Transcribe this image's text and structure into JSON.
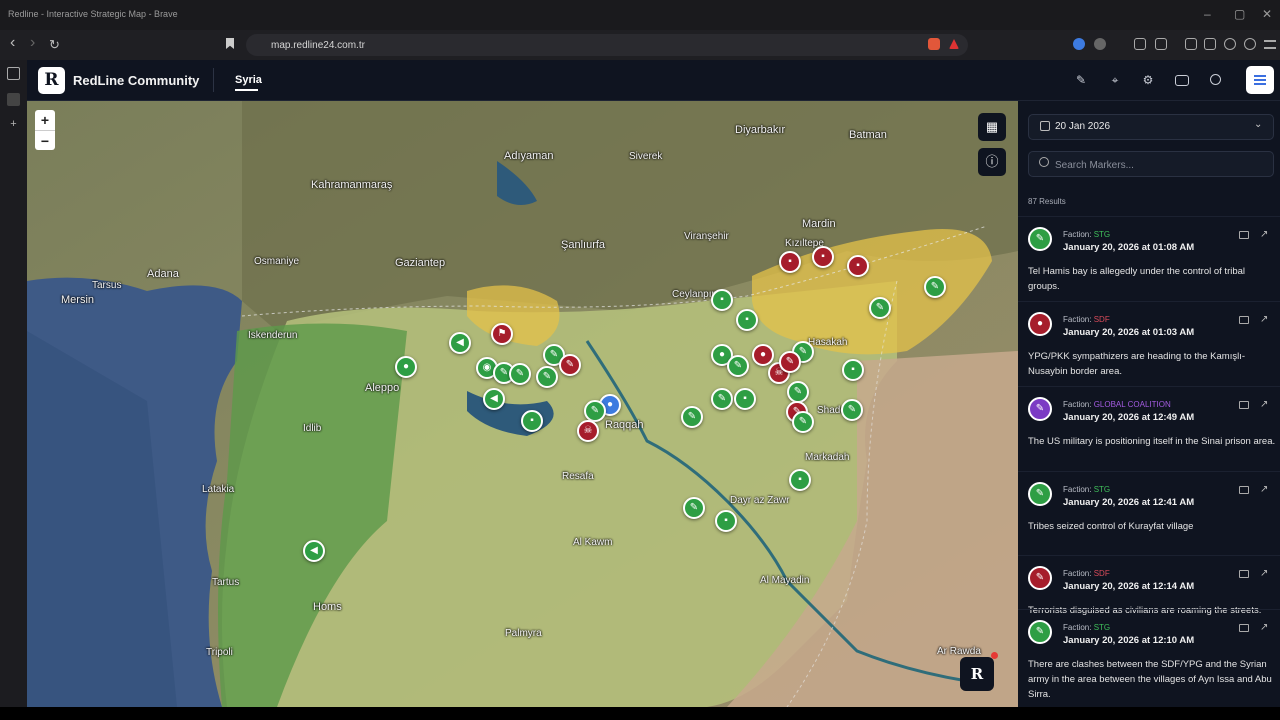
{
  "browser": {
    "window_title": "Redline - Interactive Strategic Map - Brave",
    "url": "map.redline24.com.tr",
    "back": "‹",
    "forward": "›",
    "reload": "↻",
    "minimize": "–",
    "restore": "▢",
    "close": "✕"
  },
  "app": {
    "logo_letter": "R",
    "brand": "RedLine Community",
    "active_tab": "Syria"
  },
  "map": {
    "zoom_in": "+",
    "zoom_out": "−",
    "float_letter": "R",
    "places": [
      {
        "text": "Diyarbakır",
        "big": true
      },
      {
        "text": "Batman",
        "big": true
      },
      {
        "text": "Adıyaman",
        "big": true
      },
      {
        "text": "Kahramanmaraş",
        "big": true
      },
      {
        "text": "Gaziantep",
        "big": true
      },
      {
        "text": "Şanlıurfa",
        "big": true
      },
      {
        "text": "Mardin",
        "big": true
      },
      {
        "text": "Adana",
        "big": true
      },
      {
        "text": "Mersin",
        "big": true
      },
      {
        "text": "Tarsus",
        "big": false
      },
      {
        "text": "Osmaniye",
        "big": false
      },
      {
        "text": "Iskenderun",
        "big": false
      },
      {
        "text": "Aleppo",
        "big": true
      },
      {
        "text": "Raqqah",
        "big": true
      },
      {
        "text": "Latakia",
        "big": false
      },
      {
        "text": "Homs",
        "big": true
      },
      {
        "text": "Tripoli",
        "big": false
      },
      {
        "text": "Tartus",
        "big": false
      },
      {
        "text": "Hasakah",
        "big": false
      },
      {
        "text": "Kızıltepe",
        "big": false
      },
      {
        "text": "Siverek",
        "big": false
      },
      {
        "text": "Viranşehir",
        "big": false
      },
      {
        "text": "Ceylanpınar",
        "big": false
      },
      {
        "text": "Palmyra",
        "big": false
      },
      {
        "text": "Al Mayadin",
        "big": false
      },
      {
        "text": "Idlib",
        "big": false
      },
      {
        "text": "Dayr az Zawr",
        "big": false
      },
      {
        "text": "Al Kawm",
        "big": false
      },
      {
        "text": "Resafa",
        "big": false
      },
      {
        "text": "Ar Rawda",
        "big": false
      },
      {
        "text": "Markadah",
        "big": false
      },
      {
        "text": "Shaddadi",
        "big": false
      }
    ]
  },
  "panel": {
    "date": "20 Jan 2026",
    "search_placeholder": "Search Markers...",
    "results": "87 Results",
    "items": [
      {
        "faction_label": "Faction:",
        "faction": "STG",
        "faction_color": "#3fbf5a",
        "time": "January 20, 2026 at 01:08 AM",
        "text": "Tel Hamis bay is allegedly under the control of tribal groups.",
        "icon": "rifle-icon",
        "color": "#2e9e44"
      },
      {
        "faction_label": "Faction:",
        "faction": "SDF",
        "faction_color": "#d84b5a",
        "time": "January 20, 2026 at 01:03 AM",
        "text": "YPG/PKK sympathizers are heading to the Kamışlı-Nusaybin border area.",
        "icon": "group-icon",
        "color": "#a61d2b"
      },
      {
        "faction_label": "Faction:",
        "faction": "GLOBAL COALITION",
        "faction_color": "#a35be0",
        "time": "January 20, 2026 at 12:49 AM",
        "text": "The US military is positioning itself in the Sinai prison area.",
        "icon": "rifle-icon",
        "color": "#7b3bc4"
      },
      {
        "faction_label": "Faction:",
        "faction": "STG",
        "faction_color": "#3fbf5a",
        "time": "January 20, 2026 at 12:41 AM",
        "text": "Tribes seized control of Kurayfat village",
        "icon": "rifle-icon",
        "color": "#2e9e44"
      },
      {
        "faction_label": "Faction:",
        "faction": "SDF",
        "faction_color": "#d84b5a",
        "time": "January 20, 2026 at 12:14 AM",
        "text": "Terrorists disguised as civilians are roaming the streets.",
        "icon": "rifle-icon",
        "color": "#a61d2b"
      },
      {
        "faction_label": "Faction:",
        "faction": "STG",
        "faction_color": "#3fbf5a",
        "time": "January 20, 2026 at 12:10 AM",
        "text": "There are clashes between the SDF/YPG and the Syrian army in the area between the villages of Ayn Issa and Abu Sirra.",
        "icon": "rifle-icon",
        "color": "#2e9e44"
      }
    ]
  }
}
